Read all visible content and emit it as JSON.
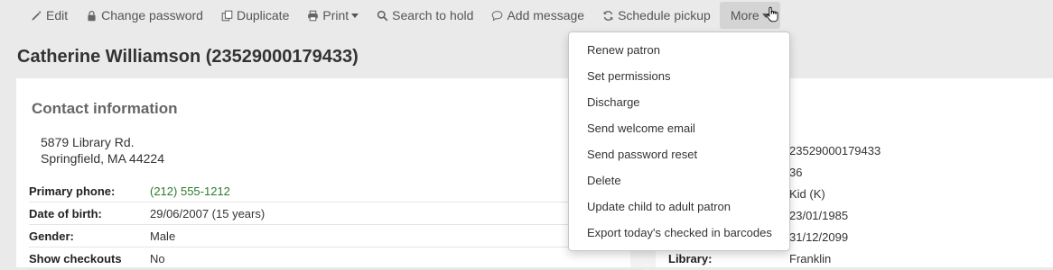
{
  "toolbar": {
    "edit": "Edit",
    "change_password": "Change password",
    "duplicate": "Duplicate",
    "print": "Print",
    "search_to_hold": "Search to hold",
    "add_message": "Add message",
    "schedule_pickup": "Schedule pickup",
    "more": "More"
  },
  "patron": {
    "title": "Catherine Williamson (23529000179433)"
  },
  "contact": {
    "heading": "Contact information",
    "address_line1": "5879 Library Rd.",
    "address_line2": "Springfield, MA 44224",
    "rows": [
      {
        "label": "Primary phone:",
        "value": "(212) 555-1212"
      },
      {
        "label": "Date of birth:",
        "value": "29/06/2007 (15 years)"
      },
      {
        "label": "Gender:",
        "value": "Male"
      },
      {
        "label": "Show checkouts",
        "value": "No"
      }
    ]
  },
  "library_info": {
    "rows": [
      {
        "label": "",
        "value": "23529000179433"
      },
      {
        "label": "",
        "value": "36"
      },
      {
        "label": "",
        "value": "Kid (K)"
      },
      {
        "label": "",
        "value": "23/01/1985"
      },
      {
        "label": "",
        "value": "31/12/2099"
      },
      {
        "label": "Library:",
        "value": "Franklin"
      }
    ]
  },
  "more_menu": {
    "items": [
      "Renew patron",
      "Set permissions",
      "Discharge",
      "Send welcome email",
      "Send password reset",
      "Delete",
      "Update child to adult patron",
      "Export today's checked in barcodes"
    ]
  },
  "colors": {
    "background": "#eaeaea",
    "phone": "#2a7a2a",
    "more_button_active": "#d4d4d4"
  }
}
